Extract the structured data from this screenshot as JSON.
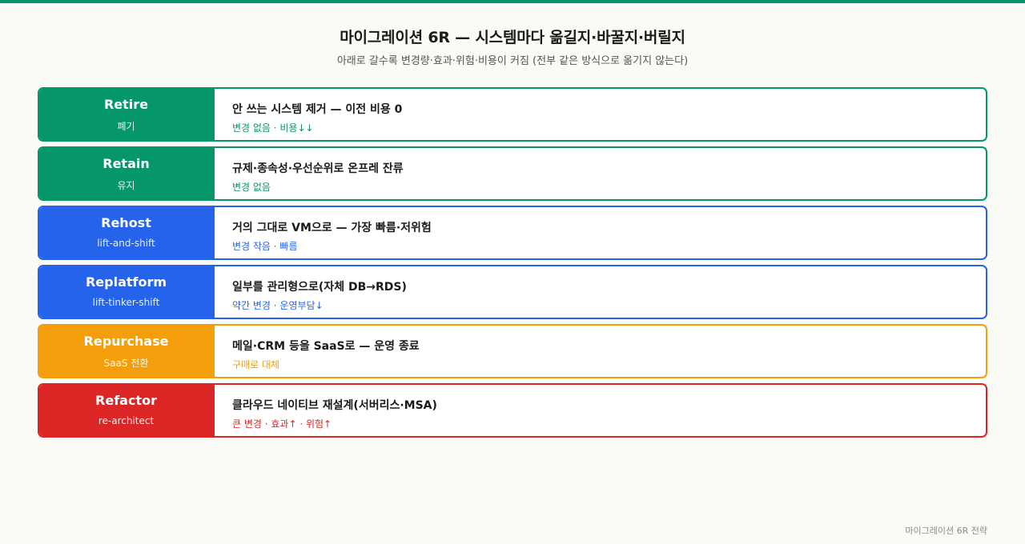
{
  "header": {
    "title": "마이그레이션 6R — 시스템마다 옮길지·바꿀지·버릴지",
    "subtitle": "아래로 갈수록 변경량·효과·위험·비용이 커짐 (전부 같은 방식으로 옮기지 않는다)"
  },
  "rows": [
    {
      "name": "Retire",
      "sub": "폐기",
      "main": "안 쓰는 시스템 제거 — 이전 비용 0",
      "note": "변경 없음 · 비용↓↓",
      "color": "#059669"
    },
    {
      "name": "Retain",
      "sub": "유지",
      "main": "규제·종속성·우선순위로 온프레 잔류",
      "note": "변경 없음",
      "color": "#059669"
    },
    {
      "name": "Rehost",
      "sub": "lift-and-shift",
      "main": "거의 그대로 VM으로 — 가장 빠름·저위험",
      "note": "변경 작음 · 빠름",
      "color": "#2563eb"
    },
    {
      "name": "Replatform",
      "sub": "lift-tinker-shift",
      "main": "일부를 관리형으로(자체 DB→RDS)",
      "note": "약간 변경 · 운영부담↓",
      "color": "#2563eb"
    },
    {
      "name": "Repurchase",
      "sub": "SaaS 전환",
      "main": "메일·CRM 등을 SaaS로 — 운영 종료",
      "note": "구매로 대체",
      "color": "#f59e0b"
    },
    {
      "name": "Refactor",
      "sub": "re-architect",
      "main": "클라우드 네이티브 재설계(서버리스·MSA)",
      "note": "큰 변경 · 효과↑ · 위험↑",
      "color": "#dc2626"
    }
  ],
  "footer": {
    "label": "마이그레이션 6R 전략"
  }
}
